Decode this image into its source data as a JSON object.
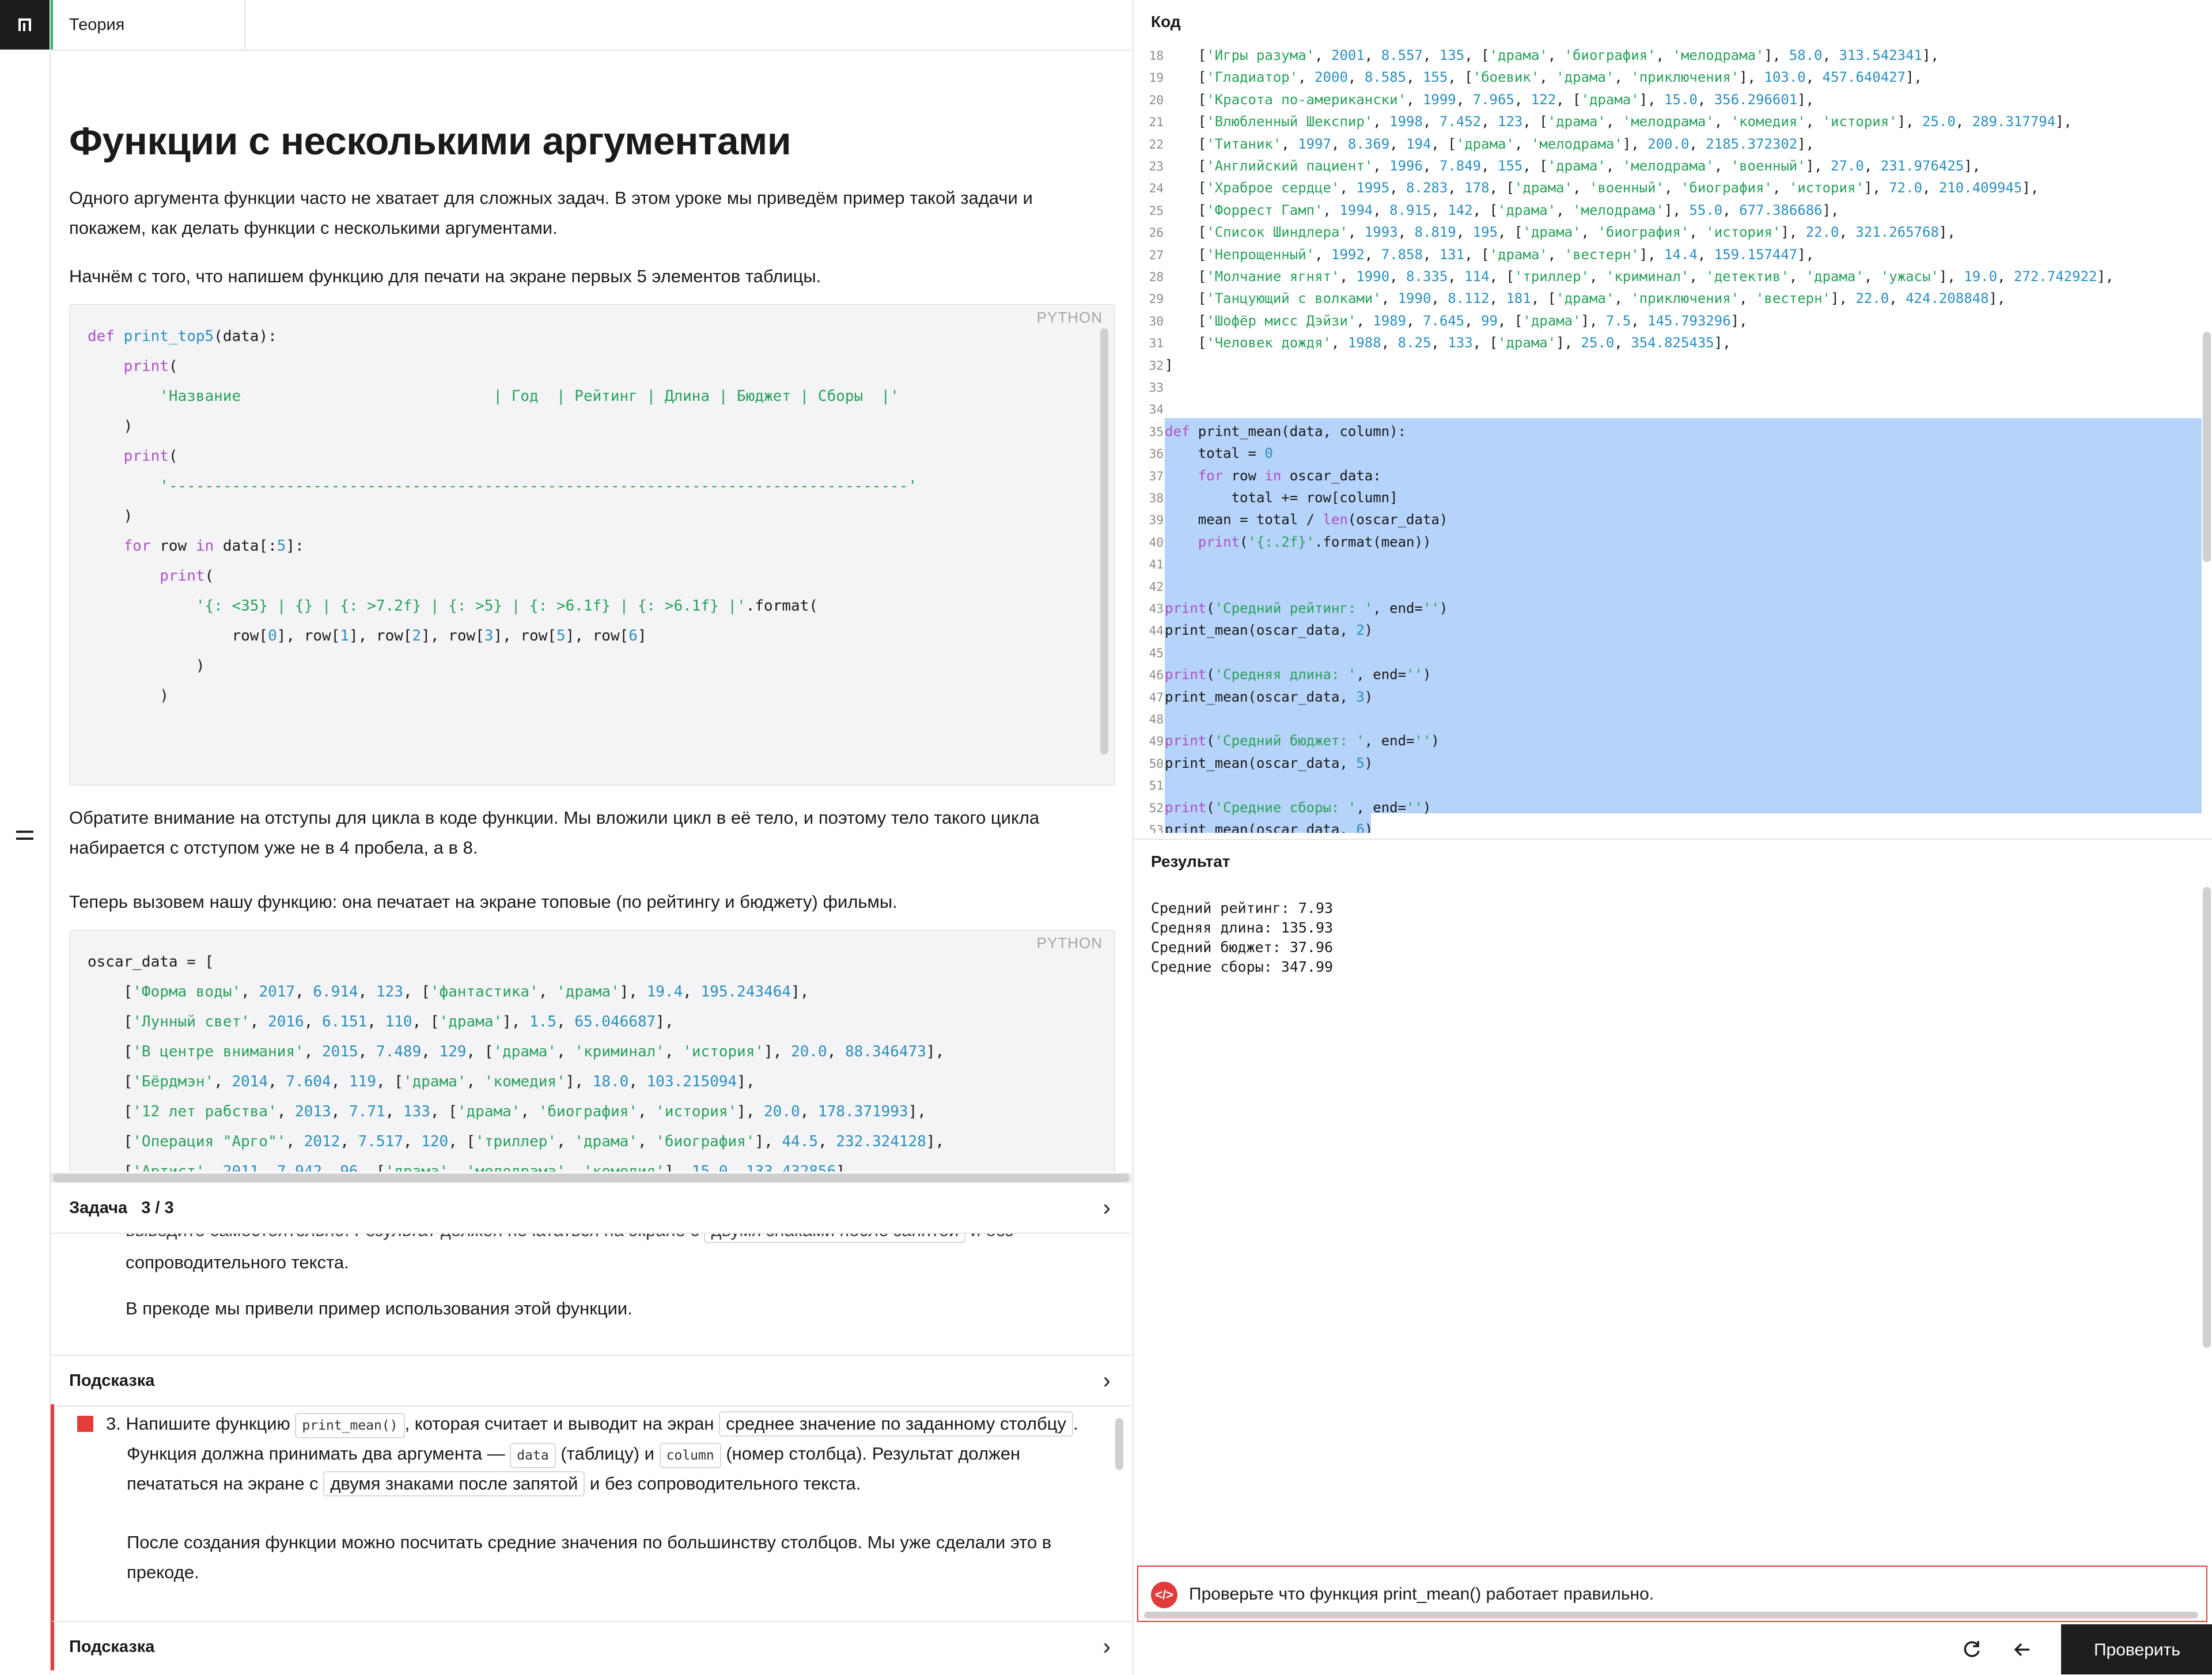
{
  "left": {
    "tab_label": "Теория",
    "title": "Функции с несколькими аргументами",
    "p1": "Одного аргумента функции часто не хватает для сложных задач. В этом уроке мы приведём пример такой задачи и покажем, как делать функции с несколькими аргументами.",
    "p2": "Начнём с того, что напишем функцию для печати на экране первых 5 элементов таблицы.",
    "lang": "PYTHON",
    "p3": "Обратите внимание на отступы для цикла в коде функции. Мы вложили цикл в её тело, и поэтому тело такого цикла набирается с отступом уже не в 4 пробела, а в 8.",
    "p4": "Теперь вызовем нашу функцию: она печатает на экране топовые (по рейтингу и бюджету) фильмы."
  },
  "task": {
    "label": "Задача",
    "counter": "3 / 3",
    "partial_line_a": "выводите самостоятельно. Результат должен печататься на экране с",
    "partial_chip": "двумя знаками после запятой",
    "partial_line_b": "и без",
    "prev_text_1": "сопроводительного текста.",
    "prev_text_2": "В прекоде мы привели пример использования этой функции.",
    "hint_label": "Подсказка",
    "item_number": "3.",
    "t1": "Напишите функцию",
    "chip_fn": "print_mean()",
    "t2": ", которая считает и выводит на экран",
    "chip_avg": "среднее значение по заданному столбцу",
    "t3": ".",
    "t4": "Функция должна принимать два аргумента —",
    "chip_data": "data",
    "t5": "(таблицу) и",
    "chip_column": "column",
    "t6": "(номер столбца). Результат должен",
    "t7": "печататься на экране с",
    "chip_two": "двумя знаками после запятой",
    "t8": "и без сопроводительного текста.",
    "after": "После создания функции можно посчитать средние значения по большинству столбцов. Мы уже сделали это в прекоде.",
    "hint_label_2": "Подсказка"
  },
  "right": {
    "code_header": "Код",
    "result_header": "Результат",
    "result_lines": "Средний рейтинг: 7.93\nСредняя длина: 135.93\nСредний бюджет: 37.96\nСредние сборы: 347.99",
    "error_text": "Проверьте что функция print_mean() работает правильно.",
    "check_label": "Проверить"
  },
  "colors": {
    "accent_red": "#e23b3b",
    "selection": "#b6d3f9",
    "tab_green": "#2bb673"
  }
}
